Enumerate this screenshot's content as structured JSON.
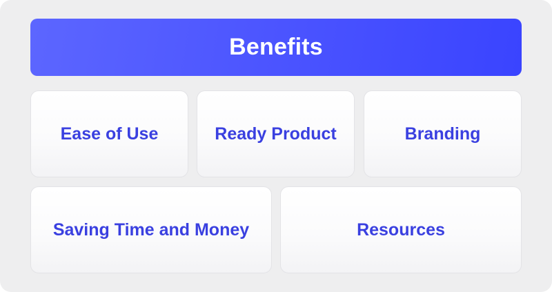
{
  "header": {
    "title": "Benefits"
  },
  "cards": [
    {
      "label": "Ease of Use"
    },
    {
      "label": "Ready Product"
    },
    {
      "label": "Branding"
    },
    {
      "label": "Saving Time and Money"
    },
    {
      "label": "Resources"
    }
  ],
  "colors": {
    "header_gradient_start": "#5c66ff",
    "header_gradient_end": "#3a44ff",
    "label_text": "#3a40e0",
    "background": "#eeeeef",
    "card_background": "#ffffff"
  }
}
